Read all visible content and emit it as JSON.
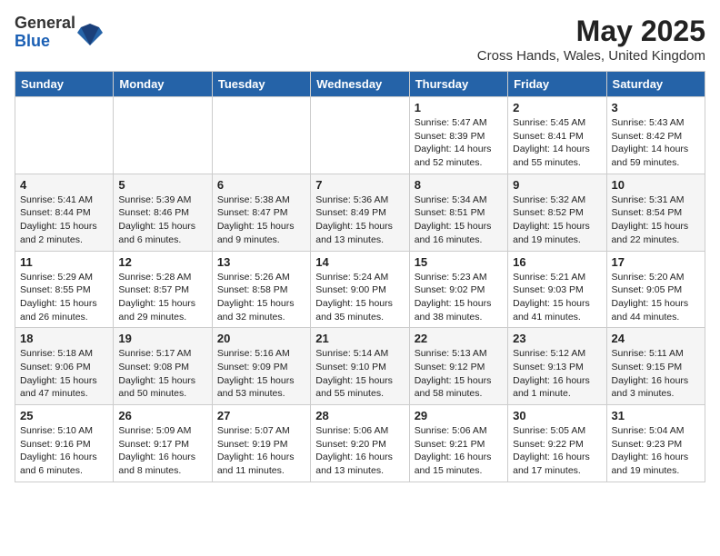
{
  "logo": {
    "general": "General",
    "blue": "Blue"
  },
  "title": {
    "month_year": "May 2025",
    "location": "Cross Hands, Wales, United Kingdom"
  },
  "weekdays": [
    "Sunday",
    "Monday",
    "Tuesday",
    "Wednesday",
    "Thursday",
    "Friday",
    "Saturday"
  ],
  "weeks": [
    [
      {
        "day": "",
        "detail": ""
      },
      {
        "day": "",
        "detail": ""
      },
      {
        "day": "",
        "detail": ""
      },
      {
        "day": "",
        "detail": ""
      },
      {
        "day": "1",
        "detail": "Sunrise: 5:47 AM\nSunset: 8:39 PM\nDaylight: 14 hours\nand 52 minutes."
      },
      {
        "day": "2",
        "detail": "Sunrise: 5:45 AM\nSunset: 8:41 PM\nDaylight: 14 hours\nand 55 minutes."
      },
      {
        "day": "3",
        "detail": "Sunrise: 5:43 AM\nSunset: 8:42 PM\nDaylight: 14 hours\nand 59 minutes."
      }
    ],
    [
      {
        "day": "4",
        "detail": "Sunrise: 5:41 AM\nSunset: 8:44 PM\nDaylight: 15 hours\nand 2 minutes."
      },
      {
        "day": "5",
        "detail": "Sunrise: 5:39 AM\nSunset: 8:46 PM\nDaylight: 15 hours\nand 6 minutes."
      },
      {
        "day": "6",
        "detail": "Sunrise: 5:38 AM\nSunset: 8:47 PM\nDaylight: 15 hours\nand 9 minutes."
      },
      {
        "day": "7",
        "detail": "Sunrise: 5:36 AM\nSunset: 8:49 PM\nDaylight: 15 hours\nand 13 minutes."
      },
      {
        "day": "8",
        "detail": "Sunrise: 5:34 AM\nSunset: 8:51 PM\nDaylight: 15 hours\nand 16 minutes."
      },
      {
        "day": "9",
        "detail": "Sunrise: 5:32 AM\nSunset: 8:52 PM\nDaylight: 15 hours\nand 19 minutes."
      },
      {
        "day": "10",
        "detail": "Sunrise: 5:31 AM\nSunset: 8:54 PM\nDaylight: 15 hours\nand 22 minutes."
      }
    ],
    [
      {
        "day": "11",
        "detail": "Sunrise: 5:29 AM\nSunset: 8:55 PM\nDaylight: 15 hours\nand 26 minutes."
      },
      {
        "day": "12",
        "detail": "Sunrise: 5:28 AM\nSunset: 8:57 PM\nDaylight: 15 hours\nand 29 minutes."
      },
      {
        "day": "13",
        "detail": "Sunrise: 5:26 AM\nSunset: 8:58 PM\nDaylight: 15 hours\nand 32 minutes."
      },
      {
        "day": "14",
        "detail": "Sunrise: 5:24 AM\nSunset: 9:00 PM\nDaylight: 15 hours\nand 35 minutes."
      },
      {
        "day": "15",
        "detail": "Sunrise: 5:23 AM\nSunset: 9:02 PM\nDaylight: 15 hours\nand 38 minutes."
      },
      {
        "day": "16",
        "detail": "Sunrise: 5:21 AM\nSunset: 9:03 PM\nDaylight: 15 hours\nand 41 minutes."
      },
      {
        "day": "17",
        "detail": "Sunrise: 5:20 AM\nSunset: 9:05 PM\nDaylight: 15 hours\nand 44 minutes."
      }
    ],
    [
      {
        "day": "18",
        "detail": "Sunrise: 5:18 AM\nSunset: 9:06 PM\nDaylight: 15 hours\nand 47 minutes."
      },
      {
        "day": "19",
        "detail": "Sunrise: 5:17 AM\nSunset: 9:08 PM\nDaylight: 15 hours\nand 50 minutes."
      },
      {
        "day": "20",
        "detail": "Sunrise: 5:16 AM\nSunset: 9:09 PM\nDaylight: 15 hours\nand 53 minutes."
      },
      {
        "day": "21",
        "detail": "Sunrise: 5:14 AM\nSunset: 9:10 PM\nDaylight: 15 hours\nand 55 minutes."
      },
      {
        "day": "22",
        "detail": "Sunrise: 5:13 AM\nSunset: 9:12 PM\nDaylight: 15 hours\nand 58 minutes."
      },
      {
        "day": "23",
        "detail": "Sunrise: 5:12 AM\nSunset: 9:13 PM\nDaylight: 16 hours\nand 1 minute."
      },
      {
        "day": "24",
        "detail": "Sunrise: 5:11 AM\nSunset: 9:15 PM\nDaylight: 16 hours\nand 3 minutes."
      }
    ],
    [
      {
        "day": "25",
        "detail": "Sunrise: 5:10 AM\nSunset: 9:16 PM\nDaylight: 16 hours\nand 6 minutes."
      },
      {
        "day": "26",
        "detail": "Sunrise: 5:09 AM\nSunset: 9:17 PM\nDaylight: 16 hours\nand 8 minutes."
      },
      {
        "day": "27",
        "detail": "Sunrise: 5:07 AM\nSunset: 9:19 PM\nDaylight: 16 hours\nand 11 minutes."
      },
      {
        "day": "28",
        "detail": "Sunrise: 5:06 AM\nSunset: 9:20 PM\nDaylight: 16 hours\nand 13 minutes."
      },
      {
        "day": "29",
        "detail": "Sunrise: 5:06 AM\nSunset: 9:21 PM\nDaylight: 16 hours\nand 15 minutes."
      },
      {
        "day": "30",
        "detail": "Sunrise: 5:05 AM\nSunset: 9:22 PM\nDaylight: 16 hours\nand 17 minutes."
      },
      {
        "day": "31",
        "detail": "Sunrise: 5:04 AM\nSunset: 9:23 PM\nDaylight: 16 hours\nand 19 minutes."
      }
    ]
  ]
}
